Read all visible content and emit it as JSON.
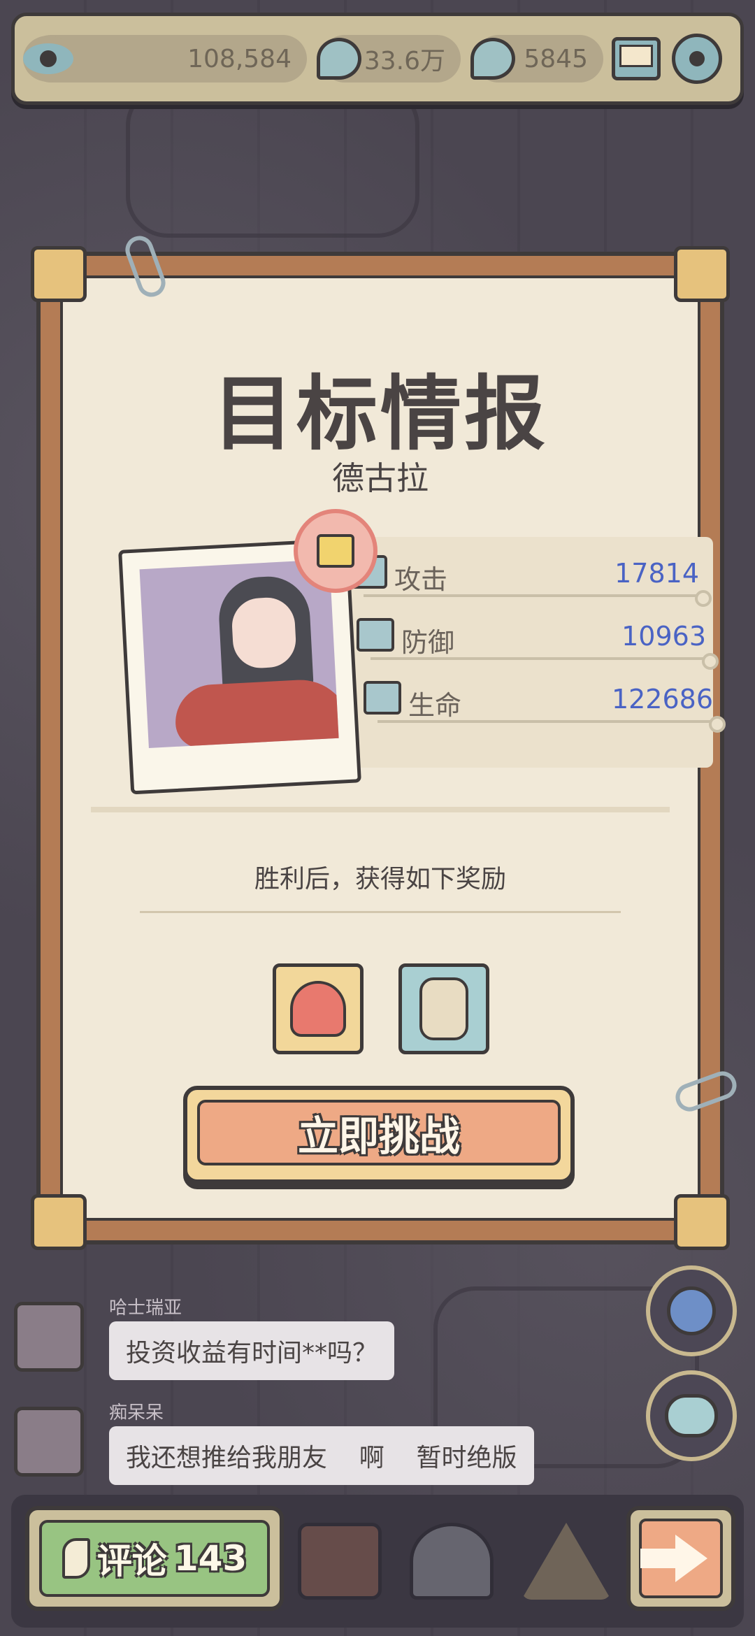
{
  "topbar": {
    "views": "108,584",
    "comments_total": "33.6万",
    "messages": "5845",
    "icons": [
      "eye-icon",
      "chat-bubble-icon",
      "speech-bubble-icon",
      "mail-icon",
      "gear-icon"
    ]
  },
  "card": {
    "title": "目标情报",
    "target_name": "德古拉",
    "stats": [
      {
        "label": "攻击",
        "value": "17814",
        "icon": "attack-icon"
      },
      {
        "label": "防御",
        "value": "10963",
        "icon": "defense-icon"
      },
      {
        "label": "生命",
        "value": "122686",
        "icon": "health-icon"
      }
    ],
    "reward_text": "胜利后，获得如下奖励",
    "rewards": [
      "ghost-icon",
      "mummy-icon"
    ],
    "challenge_label": "立即挑战",
    "value_color": "#4a63c4"
  },
  "comments": [
    {
      "name": "哈士瑞亚",
      "text": "投资收益有时间**吗？"
    },
    {
      "name": "痴呆呆",
      "text": "我还想推给我朋友    啊    暂时绝版"
    }
  ],
  "bottombar": {
    "comment_label": "评论",
    "comment_count": "143",
    "nav_icons": [
      "bag-icon",
      "bust-icon",
      "pyramid-icon"
    ],
    "next_icon": "arrow-right-icon"
  }
}
